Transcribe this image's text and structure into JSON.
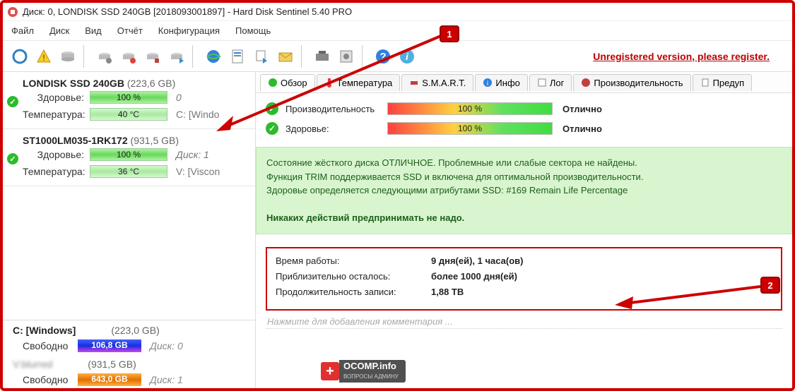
{
  "title": "Диск: 0, LONDISK SSD 240GB [2018093001897]  -  Hard Disk Sentinel 5.40 PRO",
  "menu": {
    "file": "Файл",
    "disk": "Диск",
    "view": "Вид",
    "report": "Отчёт",
    "config": "Конфигурация",
    "help": "Помощь"
  },
  "unregistered": "Unregistered version, please register.",
  "disks": [
    {
      "name": "LONDISK SSD 240GB",
      "size": "(223,6 GB)",
      "health_lbl": "Здоровье:",
      "health_val": "100 %",
      "health_after": "0",
      "temp_lbl": "Температура:",
      "temp_val": "40 °C",
      "temp_after": "C: [Windo"
    },
    {
      "name": "ST1000LM035-1RK172",
      "size": "(931,5 GB)",
      "health_lbl": "Здоровье:",
      "health_val": "100 %",
      "health_after": "Диск: 1",
      "temp_lbl": "Температура:",
      "temp_val": "36 °C",
      "temp_after": "V: [Viscon"
    }
  ],
  "partitions": [
    {
      "name": "C: [Windows]",
      "size": "(223,0 GB)",
      "free_lbl": "Свободно",
      "free_val": "106,8 GB",
      "after": "Диск: 0",
      "color": "blue"
    },
    {
      "name": "",
      "size": "(931,5 GB)",
      "free_lbl": "Свободно",
      "free_val": "643,0 GB",
      "after": "Диск: 1",
      "color": "orange"
    }
  ],
  "tabs": {
    "overview": "Обзор",
    "temp": "Температура",
    "smart": "S.M.A.R.T.",
    "info": "Инфо",
    "log": "Лог",
    "perf": "Производительность",
    "alert": "Предуп"
  },
  "details": [
    {
      "label": "Производительность",
      "value": "100 %",
      "rating": "Отлично"
    },
    {
      "label": "Здоровье:",
      "value": "100 %",
      "rating": "Отлично"
    }
  ],
  "info_text": {
    "l1": "Состояние жёсткого диска ОТЛИЧНОЕ. Проблемные или слабые сектора не найдены.",
    "l2": "Функция TRIM поддерживается SSD и включена для оптимальной производительности.",
    "l3": "Здоровье определяется следующими атрибутами SSD: #169 Remain Life Percentage",
    "l4": "Никаких действий предпринимать не надо."
  },
  "stats": [
    {
      "label": "Время работы:",
      "value": "9 дня(ей), 1 часа(ов)"
    },
    {
      "label": "Приблизительно осталось:",
      "value": "более 1000 дня(ей)"
    },
    {
      "label": "Продолжительность записи:",
      "value": "1,88 TB"
    }
  ],
  "comment_placeholder": "Нажмите для добавления комментария ...",
  "watermark": {
    "main": "OCOMP.info",
    "sub": "ВОПРОСЫ АДМИНУ"
  },
  "annot": {
    "n1": "1",
    "n2": "2"
  }
}
